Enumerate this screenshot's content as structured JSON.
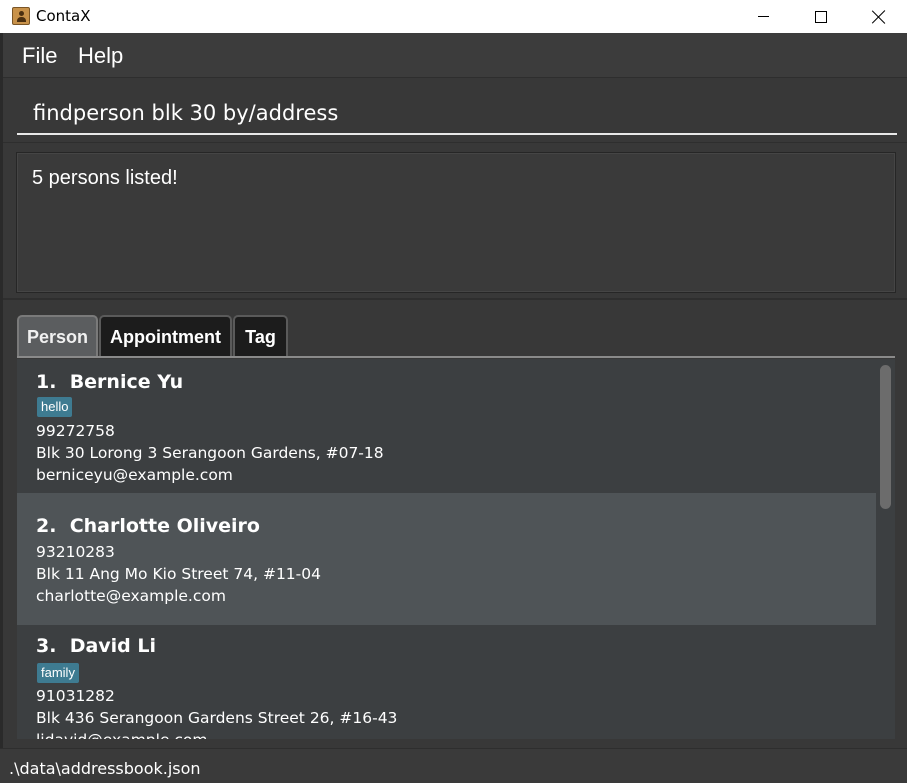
{
  "window": {
    "title": "ContaX",
    "icon": "contact-book-icon"
  },
  "menu": {
    "file_label": "File",
    "help_label": "Help"
  },
  "command": {
    "value": "findperson blk 30 by/address"
  },
  "result": {
    "message": "5 persons listed!"
  },
  "tabs": [
    {
      "label": "Person",
      "selected": true
    },
    {
      "label": "Appointment",
      "selected": false
    },
    {
      "label": "Tag",
      "selected": false
    }
  ],
  "persons": [
    {
      "index": "1.",
      "name": "Bernice Yu",
      "tag": "hello",
      "phone": "99272758",
      "address": "Blk 30 Lorong 3 Serangoon Gardens, #07-18",
      "email": "berniceyu@example.com"
    },
    {
      "index": "2.",
      "name": "Charlotte Oliveiro",
      "phone": "93210283",
      "address": "Blk 11 Ang Mo Kio Street 74, #11-04",
      "email": "charlotte@example.com"
    },
    {
      "index": "3.",
      "name": "David Li",
      "tag": "family",
      "phone": "91031282",
      "address": "Blk 436 Serangoon Gardens Street 26, #16-43",
      "email": "lidavid@example.com"
    }
  ],
  "status": {
    "file_path": ".\\data\\addressbook.json"
  },
  "colors": {
    "background": "#383838",
    "tag": "#3e7b91",
    "selected_card": "#4f5457"
  }
}
